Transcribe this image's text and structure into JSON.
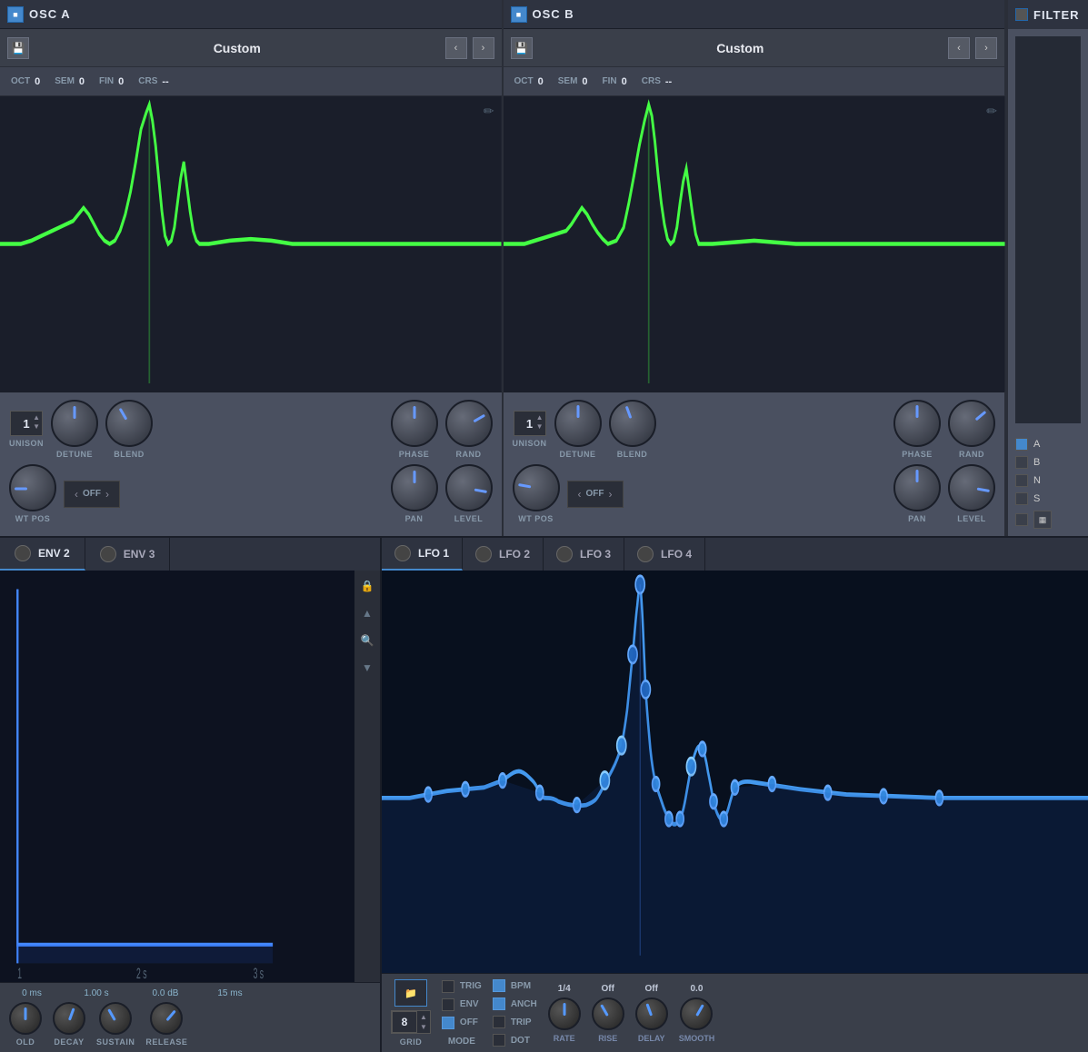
{
  "osc_a": {
    "title": "OSC A",
    "preset": "Custom",
    "tuning": {
      "oct": {
        "label": "OCT",
        "value": "0"
      },
      "sem": {
        "label": "SEM",
        "value": "0"
      },
      "fin": {
        "label": "FIN",
        "value": "0"
      },
      "crs": {
        "label": "CRS",
        "value": "--"
      }
    },
    "controls": {
      "unison": {
        "label": "UNISON",
        "value": "1"
      },
      "detune": {
        "label": "DETUNE"
      },
      "blend": {
        "label": "BLEND"
      },
      "phase": {
        "label": "PHASE"
      },
      "rand": {
        "label": "RAND"
      },
      "wt_pos": {
        "label": "WT POS"
      },
      "off": {
        "label": "OFF"
      },
      "pan": {
        "label": "PAN"
      },
      "level": {
        "label": "LEVEL"
      }
    }
  },
  "osc_b": {
    "title": "OSC B",
    "preset": "Custom",
    "tuning": {
      "oct": {
        "label": "OCT",
        "value": "0"
      },
      "sem": {
        "label": "SEM",
        "value": "0"
      },
      "fin": {
        "label": "FIN",
        "value": "0"
      },
      "crs": {
        "label": "CRS",
        "value": "--"
      }
    },
    "controls": {
      "unison": {
        "label": "UNISON",
        "value": "1"
      },
      "detune": {
        "label": "DETUNE"
      },
      "blend": {
        "label": "BLEND"
      },
      "phase": {
        "label": "PHASE"
      },
      "rand": {
        "label": "RAND"
      },
      "wt_pos": {
        "label": "WT POS"
      },
      "off": {
        "label": "OFF"
      },
      "pan": {
        "label": "PAN"
      },
      "level": {
        "label": "LEVEL"
      }
    }
  },
  "filter": {
    "title": "FILTER"
  },
  "routing": {
    "items": [
      {
        "label": "A",
        "active": true
      },
      {
        "label": "B",
        "active": false
      },
      {
        "label": "N",
        "active": false
      },
      {
        "label": "S",
        "active": false
      }
    ]
  },
  "env": {
    "tabs": [
      {
        "label": "ENV 2",
        "active": true
      },
      {
        "label": "ENV 3",
        "active": false
      }
    ],
    "ruler": [
      "1",
      "2 s",
      "3 s"
    ],
    "params": {
      "hold": {
        "label": "OLD",
        "value": "0 ms"
      },
      "decay": {
        "label": "DECAY",
        "value": "1.00 s"
      },
      "sustain": {
        "label": "SUSTAIN",
        "value": "0.0 dB"
      },
      "release": {
        "label": "RELEASE",
        "value": "15 ms"
      }
    }
  },
  "lfo": {
    "tabs": [
      {
        "label": "LFO 1",
        "active": true
      },
      {
        "label": "LFO 2",
        "active": false
      },
      {
        "label": "LFO 3",
        "active": false
      },
      {
        "label": "LFO 4",
        "active": false
      }
    ],
    "grid": {
      "label": "GRID",
      "value": "8"
    },
    "mode": {
      "label": "MODE",
      "trig": "TRIG",
      "env": "ENV",
      "off": "OFF"
    },
    "bpm_group": {
      "bpm": "BPM",
      "anch": "ANCH",
      "trip": "TRIP",
      "dot": "DOT"
    },
    "params": {
      "rate": {
        "label": "RATE",
        "value": "1/4"
      },
      "rise": {
        "label": "RISE",
        "value": "Off"
      },
      "delay": {
        "label": "DELAY",
        "value": "Off"
      },
      "smooth": {
        "label": "SMOOTH",
        "value": "0.0"
      }
    }
  },
  "icons": {
    "save": "💾",
    "prev": "‹",
    "next": "›",
    "edit": "✏",
    "lock": "🔒",
    "up": "▲",
    "down": "▼",
    "chevron_up": "^",
    "chevron_down": "v",
    "search": "🔍",
    "folder": "📁",
    "left_arrow": "‹",
    "right_arrow": "›"
  }
}
